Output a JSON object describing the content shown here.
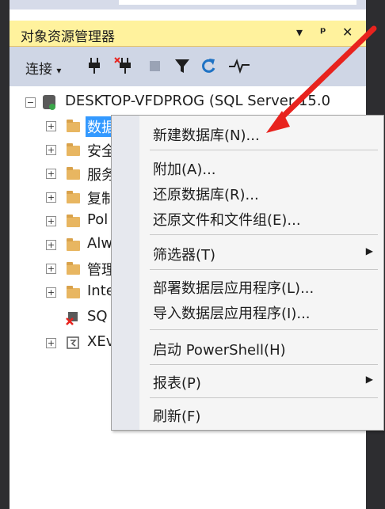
{
  "panel": {
    "title": "对象资源管理器",
    "pin_glyph": "▾",
    "pin2_glyph": "ᴾ",
    "close_glyph": "✕"
  },
  "toolbar": {
    "connect_label": "连接",
    "connect_arrow": "▾"
  },
  "tree": {
    "server": "DESKTOP-VFDPROG (SQL Server 15.0",
    "items": [
      {
        "label": "数据"
      },
      {
        "label": "安全"
      },
      {
        "label": "服务"
      },
      {
        "label": "复制"
      },
      {
        "label": "Pol"
      },
      {
        "label": "Alw"
      },
      {
        "label": "管理"
      },
      {
        "label": "Inte"
      },
      {
        "label": "SQ"
      },
      {
        "label": "XEv"
      }
    ]
  },
  "context_menu": {
    "items": [
      {
        "label": "新建数据库(N)..."
      },
      {
        "label": "附加(A)..."
      },
      {
        "label": "还原数据库(R)..."
      },
      {
        "label": "还原文件和文件组(E)..."
      },
      {
        "label": "筛选器(T)",
        "submenu": "▶"
      },
      {
        "label": "部署数据层应用程序(L)..."
      },
      {
        "label": "导入数据层应用程序(I)..."
      },
      {
        "label": "启动 PowerShell(H)"
      },
      {
        "label": "报表(P)",
        "submenu": "▶"
      },
      {
        "label": "刷新(F)"
      }
    ]
  },
  "annotation": {
    "arrow_color": "#e8231e"
  }
}
